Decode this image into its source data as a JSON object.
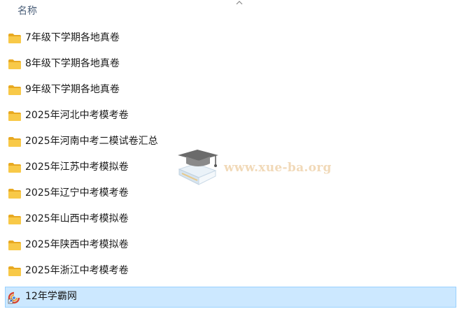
{
  "header": {
    "name_column": "名称"
  },
  "files": [
    {
      "name": "7年级下学期各地真卷",
      "icon": "folder-icon"
    },
    {
      "name": "8年级下学期各地真卷",
      "icon": "folder-icon"
    },
    {
      "name": "9年级下学期各地真卷",
      "icon": "folder-icon"
    },
    {
      "name": "2025年河北中考模考卷",
      "icon": "folder-icon"
    },
    {
      "name": "2025年河南中考二模试卷汇总",
      "icon": "folder-icon"
    },
    {
      "name": "2025年江苏中考模拟卷",
      "icon": "folder-icon"
    },
    {
      "name": "2025年辽宁中考模考卷",
      "icon": "folder-icon"
    },
    {
      "name": "2025年山西中考模拟卷",
      "icon": "folder-icon"
    },
    {
      "name": "2025年陕西中考模拟卷",
      "icon": "folder-icon"
    },
    {
      "name": "2025年浙江中考模考卷",
      "icon": "folder-icon"
    },
    {
      "name": "12年学霸网",
      "icon": "internet-shortcut-icon",
      "selected": true
    }
  ],
  "watermark": {
    "text": "www.xue-ba.org",
    "icon": "graduation-cap-book-icon"
  },
  "colors": {
    "folder": "#f8c948",
    "folder_dark": "#e8a921",
    "selection_bg": "#cce8ff",
    "selection_border": "#99d1ff",
    "header_text": "#4c607a",
    "watermark_text": "#f1d9b8"
  }
}
